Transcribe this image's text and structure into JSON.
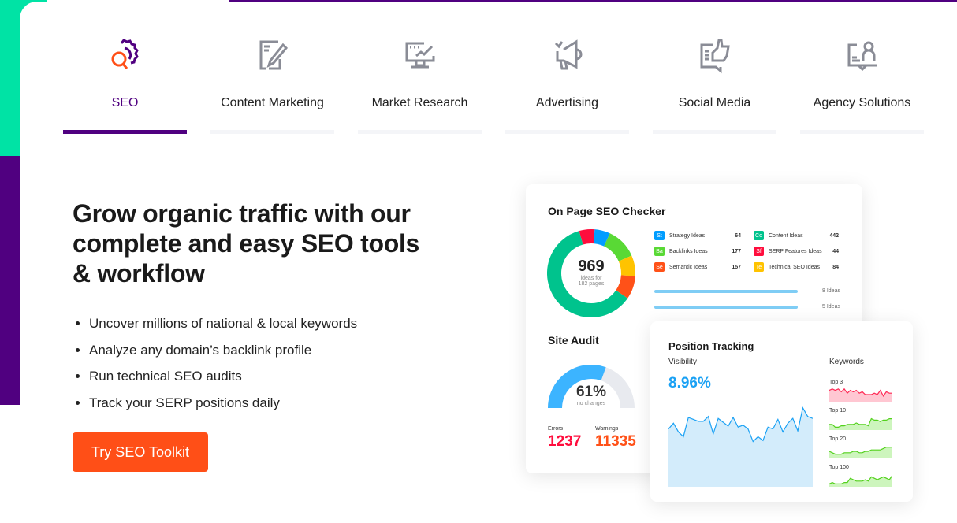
{
  "tabs": [
    {
      "label": "SEO",
      "icon": "seo-gear-magnifier-icon",
      "active": true
    },
    {
      "label": "Content Marketing",
      "icon": "document-pencil-icon"
    },
    {
      "label": "Market Research",
      "icon": "monitor-chart-icon"
    },
    {
      "label": "Advertising",
      "icon": "megaphone-icon"
    },
    {
      "label": "Social Media",
      "icon": "thumbs-up-chat-icon"
    },
    {
      "label": "Agency Solutions",
      "icon": "presenter-board-icon"
    }
  ],
  "hero": {
    "title": "Grow organic traffic with our complete and easy SEO tools & workflow",
    "bullets": [
      "Uncover millions of national & local keywords",
      "Analyze any domain’s backlink profile",
      "Run technical SEO audits",
      "Track your SERP positions daily"
    ],
    "cta": "Try SEO Toolkit"
  },
  "colors": {
    "accent": "#500080",
    "cta": "#ff4f17",
    "green": "#00e3a5",
    "blue": "#3cb4ff"
  },
  "checker": {
    "title": "On Page SEO Checker",
    "total": "969",
    "sub1": "ideas for",
    "sub2": "182 pages",
    "items": [
      {
        "abbr": "St",
        "label": "Strategy Ideas",
        "value": "64",
        "color": "#009dff"
      },
      {
        "abbr": "Ba",
        "label": "Backlinks Ideas",
        "value": "177",
        "color": "#59d935"
      },
      {
        "abbr": "Se",
        "label": "Semantic Ideas",
        "value": "157",
        "color": "#ff5118"
      },
      {
        "abbr": "Co",
        "label": "Content Ideas",
        "value": "442",
        "color": "#00c38d"
      },
      {
        "abbr": "Sf",
        "label": "SERP Features Ideas",
        "value": "44",
        "color": "#ff0d3d"
      },
      {
        "abbr": "Te",
        "label": "Technical SEO Ideas",
        "value": "84",
        "color": "#ffc300"
      }
    ],
    "bars": [
      {
        "label": "8 Ideas"
      },
      {
        "label": "5 Ideas"
      }
    ]
  },
  "audit": {
    "title": "Site Audit",
    "percent": "61%",
    "percent_value": 61,
    "sub": "no changes",
    "errors_label": "Errors",
    "errors": "1237",
    "warnings_label": "Warnings",
    "warnings": "11335"
  },
  "tracking": {
    "title": "Position Tracking",
    "visibility_label": "Visibility",
    "visibility": "8.96%",
    "keywords_label": "Keywords",
    "visibility_series": [
      60,
      66,
      57,
      52,
      72,
      70,
      68,
      68,
      73,
      55,
      71,
      67,
      63,
      72,
      62,
      64,
      60,
      47,
      52,
      48,
      62,
      60,
      70,
      57,
      66,
      71,
      58,
      82,
      73,
      71
    ],
    "sparks": [
      {
        "label": "Top 3",
        "color": "#ff2a55",
        "fill": "#ffc7d2",
        "values": [
          8,
          9,
          8,
          9,
          7,
          9,
          6,
          8,
          7,
          8,
          6,
          7,
          5,
          5,
          5,
          6,
          5,
          8,
          4,
          7,
          6,
          6
        ]
      },
      {
        "label": "Top 10",
        "color": "#53d11d",
        "fill": "#cdf5bd",
        "values": [
          4,
          4,
          2,
          2,
          3,
          3,
          4,
          4,
          4,
          5,
          4,
          4,
          4,
          3,
          8,
          7,
          7,
          6,
          7,
          7,
          8,
          8
        ]
      },
      {
        "label": "Top 20",
        "color": "#53d11d",
        "fill": "#cdf5bd",
        "values": [
          5,
          4,
          3,
          3,
          3,
          4,
          4,
          4,
          5,
          5,
          4,
          4,
          5,
          5,
          6,
          6,
          6,
          6,
          7,
          8,
          8,
          8
        ]
      },
      {
        "label": "Top 100",
        "color": "#53d11d",
        "fill": "#cdf5bd",
        "values": [
          2,
          3,
          2,
          2,
          2,
          3,
          3,
          6,
          5,
          4,
          4,
          4,
          5,
          4,
          7,
          6,
          5,
          6,
          7,
          6,
          5,
          8
        ]
      }
    ]
  }
}
